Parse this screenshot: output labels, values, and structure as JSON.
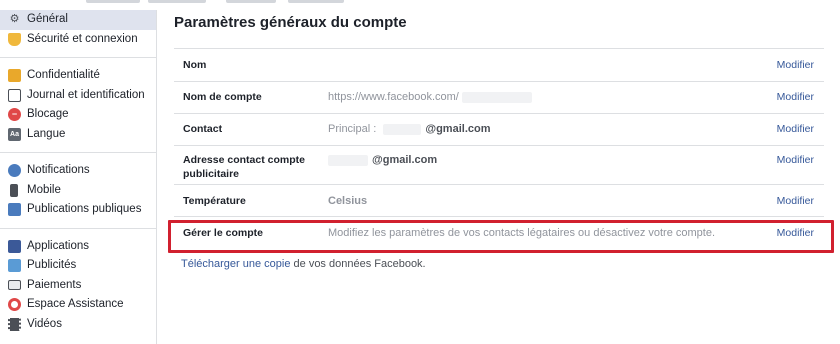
{
  "sidebar": {
    "groups": [
      [
        {
          "label": "Général",
          "icon": "gear-icon",
          "active": true
        },
        {
          "label": "Sécurité et connexion",
          "icon": "shield-icon"
        }
      ],
      [
        {
          "label": "Confidentialité",
          "icon": "lock-icon"
        },
        {
          "label": "Journal et identification",
          "icon": "timeline-icon"
        },
        {
          "label": "Blocage",
          "icon": "block-icon"
        },
        {
          "label": "Langue",
          "icon": "language-icon"
        }
      ],
      [
        {
          "label": "Notifications",
          "icon": "globe-icon"
        },
        {
          "label": "Mobile",
          "icon": "mobile-icon"
        },
        {
          "label": "Publications publiques",
          "icon": "rss-icon"
        }
      ],
      [
        {
          "label": "Applications",
          "icon": "apps-icon"
        },
        {
          "label": "Publicités",
          "icon": "ads-icon"
        },
        {
          "label": "Paiements",
          "icon": "payment-icon"
        },
        {
          "label": "Espace Assistance",
          "icon": "lifebuoy-icon"
        },
        {
          "label": "Vidéos",
          "icon": "film-icon"
        }
      ]
    ]
  },
  "main": {
    "title": "Paramètres généraux du compte",
    "rows": [
      {
        "label": "Nom",
        "value": "",
        "value_bold": "",
        "edit": "Modifier"
      },
      {
        "label": "Nom de compte",
        "value": "https://www.facebook.com/",
        "value_bold": "",
        "edit": "Modifier"
      },
      {
        "label": "Contact",
        "value": "Principal :",
        "value_bold": "@gmail.com",
        "edit": "Modifier"
      },
      {
        "label": "Adresse contact compte publicitaire",
        "value": "",
        "value_bold": "@gmail.com",
        "edit": "Modifier"
      },
      {
        "label": "Température",
        "value": "",
        "value_bold": "Celsius",
        "edit": "Modifier"
      },
      {
        "label": "Gérer le compte",
        "value": "Modifiez les paramètres de vos contacts légataires ou désactivez votre compte.",
        "value_bold": "",
        "edit": "Modifier"
      }
    ],
    "footer": {
      "link": "Télécharger une copie",
      "rest": " de vos données Facebook."
    }
  },
  "colors": {
    "link": "#365899",
    "highlight": "#d1202f",
    "active_bg": "#dfe3ee"
  }
}
